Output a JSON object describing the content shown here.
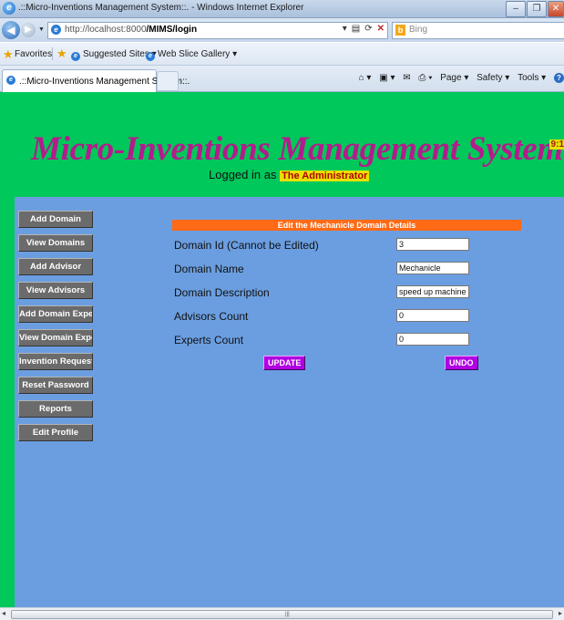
{
  "browser": {
    "window_title": ".::Micro-Inventions Management System::. - Windows Internet Explorer",
    "address_host": "http://localhost:8000",
    "address_path": "/MIMS/login",
    "search_placeholder": "Bing",
    "favorites_label": "Favorites",
    "suggested_sites": "Suggested Sites ▾",
    "web_slice_gallery": "Web Slice Gallery ▾",
    "tab_title": ".::Micro-Inventions Management System::.",
    "cmd_page": "Page ▾",
    "cmd_safety": "Safety ▾",
    "cmd_tools": "Tools ▾"
  },
  "header": {
    "brand": "Micro-Inventions Management System",
    "logged_in_prefix": "Logged in as",
    "user": "The Administrator",
    "clock": "9:1"
  },
  "menu": [
    "Add Domain",
    "View Domains",
    "Add Advisor",
    "View Advisors",
    "Add Domain Expert",
    "View Domain Experts",
    "Invention Requests",
    "Reset Password",
    "Reports",
    "Edit Profile"
  ],
  "form": {
    "title": "Edit the Mechanicle Domain Details",
    "fields": [
      {
        "label": "Domain Id (Cannot be Edited)",
        "value": "3"
      },
      {
        "label": "Domain Name",
        "value": "Mechanicle"
      },
      {
        "label": "Domain Description",
        "value": "speed up machine gene"
      },
      {
        "label": "Advisors Count",
        "value": "0"
      },
      {
        "label": "Experts Count",
        "value": "0"
      }
    ],
    "update_label": "UPDATE",
    "undo_label": "UNDO"
  },
  "colors": {
    "header_green": "#00c85a",
    "content_blue": "#6b9ee0",
    "brand_magenta": "#b41b8c",
    "form_header_orange": "#ff6a16",
    "button_purple": "#b100e3",
    "menu_gray": "#6b6b6b"
  }
}
